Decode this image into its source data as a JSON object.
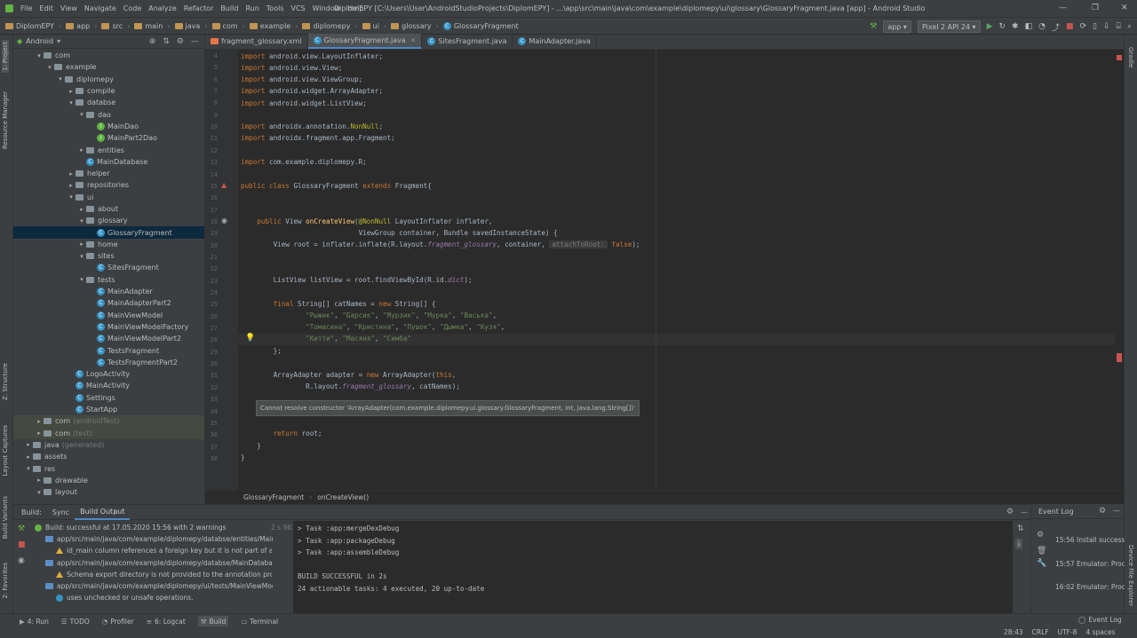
{
  "menu": {
    "items": [
      "File",
      "Edit",
      "View",
      "Navigate",
      "Code",
      "Analyze",
      "Refactor",
      "Build",
      "Run",
      "Tools",
      "VCS",
      "Window",
      "Help"
    ],
    "window_title": "DiplomEPY [C:\\Users\\User\\AndroidStudioProjects\\DiplomEPY] - ...\\app\\src\\main\\java\\com\\example\\diplomepy\\ui\\glossary\\GlossaryFragment.java [app] - Android Studio"
  },
  "nav": {
    "crumbs": [
      "DiplomEPY",
      "app",
      "src",
      "main",
      "java",
      "com",
      "example",
      "diplomepy",
      "ui",
      "glossary",
      "GlossaryFragment"
    ],
    "run_config": "app",
    "device": "Pixel 2 API 24"
  },
  "left_strip": {
    "tabs": [
      "1: Project",
      "Resource Manager",
      "Z: Structure",
      "Layout Captures",
      "Build Variants",
      "2: Favorites"
    ]
  },
  "right_strip": {
    "tabs": [
      "Gradle",
      "Device File Explorer"
    ]
  },
  "project": {
    "view": "Android",
    "tree": [
      {
        "label": "com",
        "depth": 2,
        "arrow": "▾",
        "icon": "folder"
      },
      {
        "label": "example",
        "depth": 3,
        "arrow": "▾",
        "icon": "folder"
      },
      {
        "label": "diplomepy",
        "depth": 4,
        "arrow": "▾",
        "icon": "folder"
      },
      {
        "label": "compile",
        "depth": 5,
        "arrow": "▸",
        "icon": "folder"
      },
      {
        "label": "databse",
        "depth": 5,
        "arrow": "▾",
        "icon": "folder"
      },
      {
        "label": "dao",
        "depth": 6,
        "arrow": "▾",
        "icon": "folder"
      },
      {
        "label": "MainDao",
        "depth": 7,
        "arrow": "",
        "icon": "interface"
      },
      {
        "label": "MainPart2Dao",
        "depth": 7,
        "arrow": "",
        "icon": "interface"
      },
      {
        "label": "entities",
        "depth": 6,
        "arrow": "▸",
        "icon": "folder"
      },
      {
        "label": "MainDatabase",
        "depth": 6,
        "arrow": "",
        "icon": "class"
      },
      {
        "label": "helper",
        "depth": 5,
        "arrow": "▸",
        "icon": "folder"
      },
      {
        "label": "repositories",
        "depth": 5,
        "arrow": "▸",
        "icon": "folder"
      },
      {
        "label": "ui",
        "depth": 5,
        "arrow": "▾",
        "icon": "folder"
      },
      {
        "label": "about",
        "depth": 6,
        "arrow": "▸",
        "icon": "folder"
      },
      {
        "label": "glossary",
        "depth": 6,
        "arrow": "▾",
        "icon": "folder"
      },
      {
        "label": "GlossaryFragment",
        "depth": 7,
        "arrow": "",
        "icon": "class",
        "selected": true
      },
      {
        "label": "home",
        "depth": 6,
        "arrow": "▸",
        "icon": "folder"
      },
      {
        "label": "sites",
        "depth": 6,
        "arrow": "▾",
        "icon": "folder"
      },
      {
        "label": "SitesFragment",
        "depth": 7,
        "arrow": "",
        "icon": "class"
      },
      {
        "label": "tests",
        "depth": 6,
        "arrow": "▾",
        "icon": "folder"
      },
      {
        "label": "MainAdapter",
        "depth": 7,
        "arrow": "",
        "icon": "class"
      },
      {
        "label": "MainAdapterPart2",
        "depth": 7,
        "arrow": "",
        "icon": "class"
      },
      {
        "label": "MainViewModel",
        "depth": 7,
        "arrow": "",
        "icon": "class"
      },
      {
        "label": "MainViewModelFactory",
        "depth": 7,
        "arrow": "",
        "icon": "class"
      },
      {
        "label": "MainViewModelPart2",
        "depth": 7,
        "arrow": "",
        "icon": "class"
      },
      {
        "label": "TestsFragment",
        "depth": 7,
        "arrow": "",
        "icon": "class"
      },
      {
        "label": "TestsFragmentPart2",
        "depth": 7,
        "arrow": "",
        "icon": "class"
      },
      {
        "label": "LogoActivity",
        "depth": 5,
        "arrow": "",
        "icon": "class"
      },
      {
        "label": "MainActivity",
        "depth": 5,
        "arrow": "",
        "icon": "class"
      },
      {
        "label": "Settings",
        "depth": 5,
        "arrow": "",
        "icon": "class"
      },
      {
        "label": "StartApp",
        "depth": 5,
        "arrow": "",
        "icon": "class"
      },
      {
        "label": "com",
        "suffix": "(androidTest)",
        "depth": 2,
        "arrow": "▸",
        "icon": "folder",
        "highlight": true
      },
      {
        "label": "com",
        "suffix": "(test)",
        "depth": 2,
        "arrow": "▸",
        "icon": "folder",
        "highlight": true
      },
      {
        "label": "java",
        "suffix": "(generated)",
        "depth": 1,
        "arrow": "▸",
        "icon": "folder"
      },
      {
        "label": "assets",
        "depth": 1,
        "arrow": "▸",
        "icon": "folder"
      },
      {
        "label": "res",
        "depth": 1,
        "arrow": "▾",
        "icon": "folder"
      },
      {
        "label": "drawable",
        "depth": 2,
        "arrow": "▸",
        "icon": "folder"
      },
      {
        "label": "layout",
        "depth": 2,
        "arrow": "▾",
        "icon": "folder"
      }
    ]
  },
  "tabs": [
    {
      "label": "fragment_glossary.xml",
      "active": false
    },
    {
      "label": "GlossaryFragment.java",
      "active": true
    },
    {
      "label": "SitesFragment.java",
      "active": false
    },
    {
      "label": "MainAdapter.java",
      "active": false
    }
  ],
  "editor": {
    "line_numbers": [
      "4",
      "5",
      "6",
      "7",
      "8",
      "9",
      "10",
      "11",
      "12",
      "13",
      "14",
      "15",
      "16",
      "17",
      "18",
      "19",
      "20",
      "21",
      "22",
      "23",
      "24",
      "25",
      "26",
      "27",
      "28",
      "29",
      "30",
      "31",
      "32",
      "33",
      "34",
      "35",
      "36",
      "37",
      "38"
    ],
    "error_tooltip": "Cannot resolve constructor 'ArrayAdapter(com.example.diplomepy.ui.glossary.GlossaryFragment, int, java.lang.String[])'",
    "breadcrumb": [
      "GlossaryFragment",
      "onCreateView()"
    ]
  },
  "build": {
    "label": "Build:",
    "tabs": [
      "Sync",
      "Build Output"
    ],
    "tree": [
      {
        "text": "Build: successful at 17.05.2020 15:56 with 2 warnings",
        "time": "2 s 961 ms",
        "icon": "ok"
      },
      {
        "text": "app/src/main/java/com/example/diplomepy/databse/entities/MainTest",
        "icon": "folder"
      },
      {
        "text": "id_main column references a foreign key but it is not part of an index",
        "icon": "warn"
      },
      {
        "text": "app/src/main/java/com/example/diplomepy/databse/MainDatabase.java",
        "icon": "folder"
      },
      {
        "text": "Schema export directory is not provided to the annotation processor",
        "icon": "warn"
      },
      {
        "text": "app/src/main/java/com/example/diplomepy/ui/tests/MainViewModelFa",
        "icon": "folder"
      },
      {
        "text": "uses unchecked or unsafe operations.",
        "icon": "info"
      }
    ],
    "console": [
      "> Task :app:mergeDexDebug",
      "> Task :app:packageDebug",
      "> Task :app:assembleDebug",
      "",
      "BUILD SUCCESSFUL in 2s",
      "24 actionable tasks: 4 executed, 20 up-to-date"
    ]
  },
  "event_log": {
    "title": "Event Log",
    "entries": [
      {
        "time": "15:56",
        "text": "Install successfu"
      },
      {
        "time": "15:57",
        "text": "Emulator: Proce"
      },
      {
        "time": "16:02",
        "text": "Emulator: Proce"
      }
    ]
  },
  "status": {
    "tools": [
      "4: Run",
      "TODO",
      "Profiler",
      "6: Logcat",
      "Build",
      "Terminal"
    ],
    "right": [
      "28:43",
      "CRLF",
      "UTF-8",
      "4 spaces"
    ],
    "event_log": "Event Log"
  }
}
